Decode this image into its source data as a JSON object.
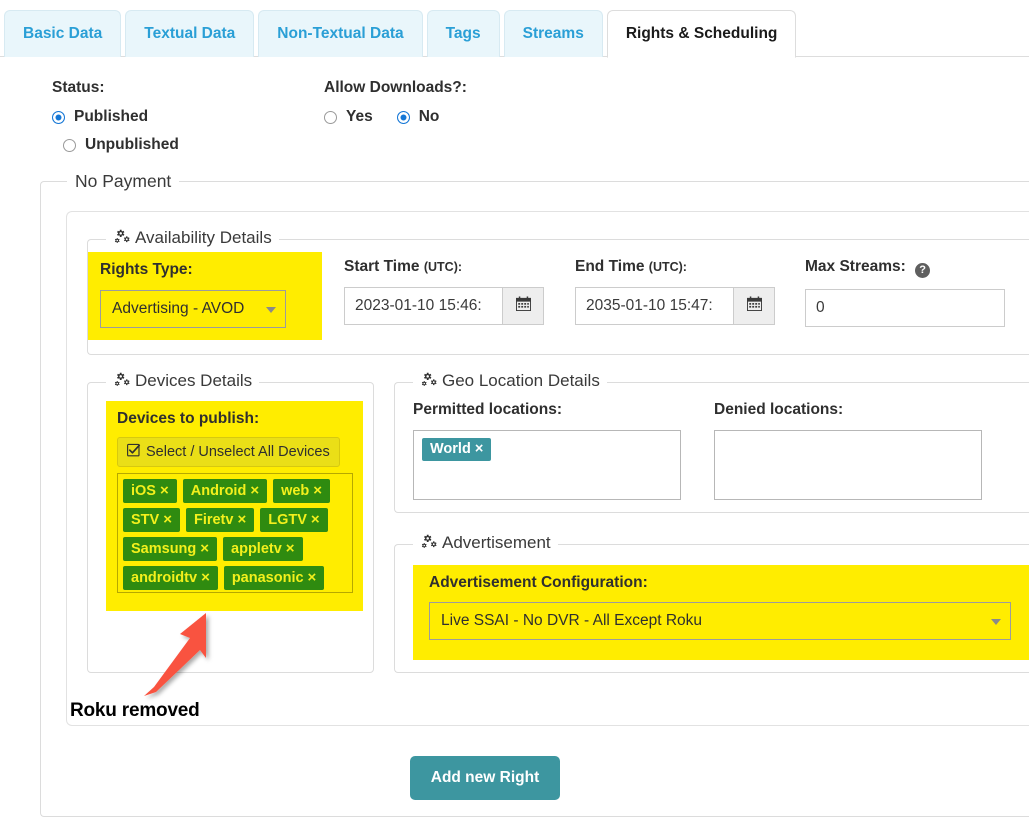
{
  "tabs": [
    {
      "label": "Basic Data",
      "active": false
    },
    {
      "label": "Textual Data",
      "active": false
    },
    {
      "label": "Non-Textual Data",
      "active": false
    },
    {
      "label": "Tags",
      "active": false
    },
    {
      "label": "Streams",
      "active": false
    },
    {
      "label": "Rights & Scheduling",
      "active": true
    }
  ],
  "status": {
    "label": "Status:",
    "options": [
      {
        "label": "Published",
        "checked": true
      },
      {
        "label": "Unpublished",
        "checked": false
      }
    ]
  },
  "downloads": {
    "label": "Allow Downloads?:",
    "options": [
      {
        "label": "Yes",
        "checked": false
      },
      {
        "label": "No",
        "checked": true
      }
    ]
  },
  "payment": {
    "legend": "No Payment"
  },
  "availability": {
    "legend": "Availability Details",
    "rights_type": {
      "label": "Rights Type:",
      "value": "Advertising - AVOD"
    },
    "start_time": {
      "label": "Start Time",
      "unit": "(UTC):",
      "value": "2023-01-10 15:46:",
      "icon": "calendar-icon"
    },
    "end_time": {
      "label": "End Time",
      "unit": "(UTC):",
      "value": "2035-01-10 15:47:",
      "icon": "calendar-icon"
    },
    "max_streams": {
      "label": "Max Streams:",
      "value": "0",
      "help": "?"
    }
  },
  "devices": {
    "legend": "Devices Details",
    "label": "Devices to publish:",
    "select_all": "Select / Unselect All Devices",
    "select_all_icon": "checkbox-checked-icon",
    "tags": [
      "iOS",
      "Android",
      "web",
      "STV",
      "Firetv",
      "LGTV",
      "Samsung",
      "appletv",
      "androidtv",
      "panasonic"
    ],
    "remove_glyph": "×"
  },
  "geo": {
    "legend": "Geo Location Details",
    "permitted": {
      "label": "Permitted locations:",
      "chips": [
        "World"
      ]
    },
    "denied": {
      "label": "Denied locations:",
      "chips": []
    }
  },
  "advertisement": {
    "legend": "Advertisement",
    "label": "Advertisement Configuration:",
    "value": "Live SSAI - No DVR - All Except Roku"
  },
  "annotation": {
    "text": "Roku removed",
    "arrow_color": "#f9523f"
  },
  "footer": {
    "add_new_right": "Add new Right"
  },
  "colors": {
    "highlight": "#ffed00",
    "tag_bg": "#2f8b10",
    "tag_fg": "#f3f01c",
    "chip_bg": "#3d96a0",
    "accent": "#3d96a0",
    "tab_link": "#2a9fd6"
  }
}
